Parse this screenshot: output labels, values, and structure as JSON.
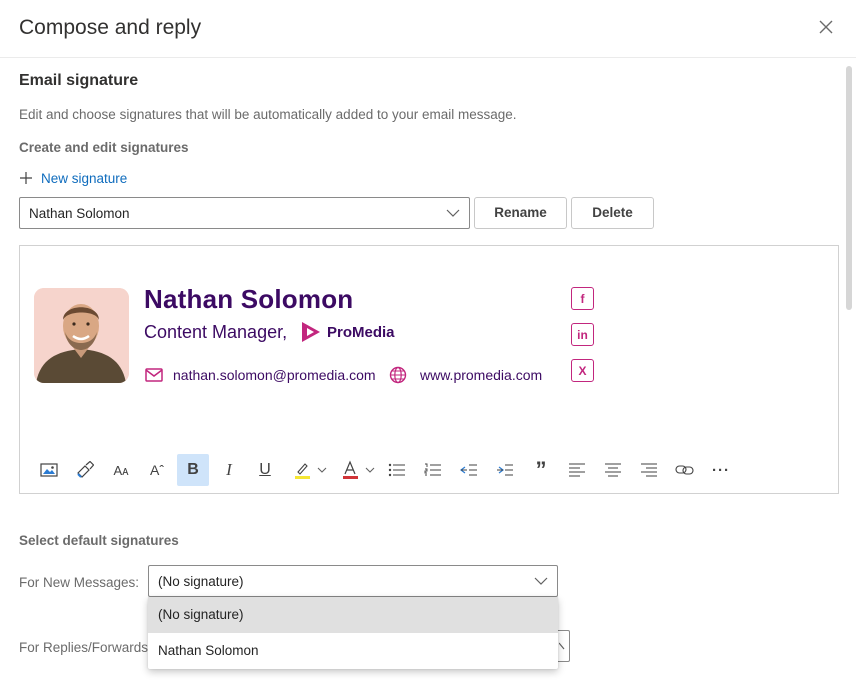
{
  "dialog": {
    "title": "Compose and reply",
    "close_icon": "close-icon"
  },
  "signature_section": {
    "title": "Email signature",
    "description": "Edit and choose signatures that will be automatically added to your email message.",
    "create_title": "Create and edit signatures",
    "new_signature_label": "New signature",
    "selected_signature": "Nathan Solomon",
    "rename_label": "Rename",
    "delete_label": "Delete"
  },
  "signature": {
    "name": "Nathan Solomon",
    "role": "Content Manager,",
    "brand": "ProMedia",
    "email": "nathan.solomon@promedia.com",
    "website": "www.promedia.com",
    "social": [
      "f",
      "in",
      "X"
    ],
    "colors": {
      "name": "#3c0a63",
      "accent": "#c2267e"
    }
  },
  "toolbar": {
    "buttons": [
      "insert-image-icon",
      "format-painter-icon",
      "font-size-icon",
      "grow-font-icon",
      "bold-icon",
      "italic-icon",
      "underline-icon",
      "highlight-icon",
      "font-color-icon",
      "bullets-icon",
      "numbering-icon",
      "decrease-indent-icon",
      "increase-indent-icon",
      "quote-icon",
      "align-left-icon",
      "align-center-icon",
      "align-right-icon",
      "link-icon",
      "more-options-icon"
    ],
    "bold_label": "B",
    "italic_label": "I",
    "underline_label": "U",
    "quote_label": "”",
    "more_label": "···",
    "font_size_label": "Aᴀ",
    "grow_font_label": "Aˆ"
  },
  "defaults": {
    "title": "Select default signatures",
    "new_messages_label": "For New Messages:",
    "replies_label": "For Replies/Forwards",
    "new_messages_value": "(No signature)",
    "options": [
      "(No signature)",
      "Nathan Solomon"
    ]
  }
}
